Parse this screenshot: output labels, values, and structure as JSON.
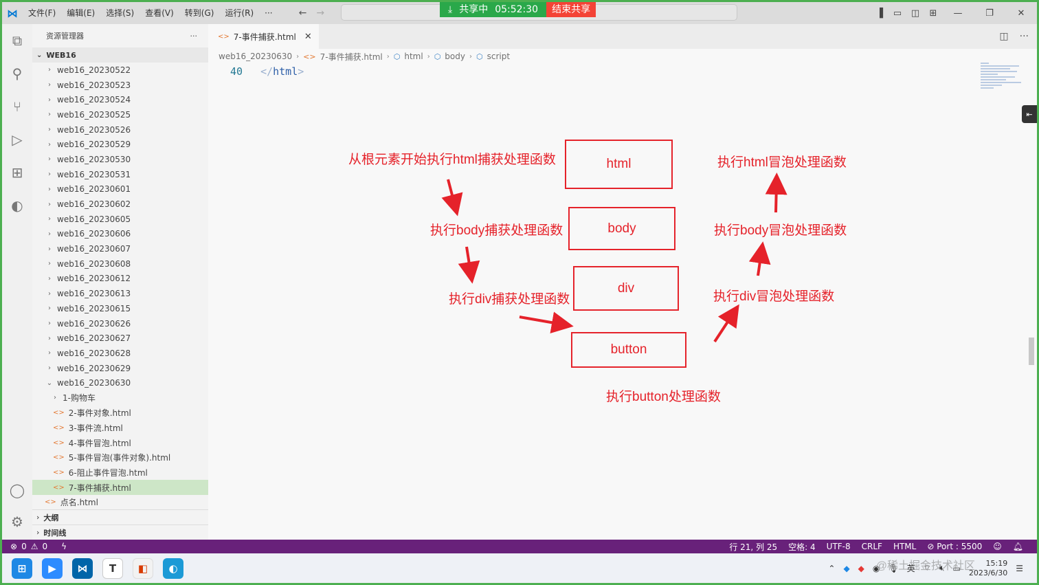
{
  "menu": [
    "文件(F)",
    "编辑(E)",
    "选择(S)",
    "查看(V)",
    "转到(G)",
    "运行(R)",
    "···"
  ],
  "share": {
    "status": "共享中",
    "timer": "05:52:30",
    "end_label": "结束共享"
  },
  "sidebar": {
    "title": "资源管理器",
    "more": "···",
    "root": "WEB16",
    "folders": [
      "web16_20230522",
      "web16_20230523",
      "web16_20230524",
      "web16_20230525",
      "web16_20230526",
      "web16_20230529",
      "web16_20230530",
      "web16_20230531",
      "web16_20230601",
      "web16_20230602",
      "web16_20230605",
      "web16_20230606",
      "web16_20230607",
      "web16_20230608",
      "web16_20230612",
      "web16_20230613",
      "web16_20230615",
      "web16_20230626",
      "web16_20230627",
      "web16_20230628",
      "web16_20230629"
    ],
    "open_folder": "web16_20230630",
    "children": [
      "1-购物车",
      "2-事件对象.html",
      "3-事件流.html",
      "4-事件冒泡.html",
      "5-事件冒泡(事件对象).html",
      "6-阻止事件冒泡.html",
      "7-事件捕获.html"
    ],
    "root_file": "点名.html",
    "outline": "大纲",
    "timeline": "时间线"
  },
  "tab": {
    "label": "7-事件捕获.html"
  },
  "breadcrumb": [
    "web16_20230630",
    "7-事件捕获.html",
    "html",
    "body",
    "script"
  ],
  "code": {
    "line_number": "40",
    "text": "</html>"
  },
  "diagram": {
    "boxes": [
      "html",
      "body",
      "div",
      "button"
    ],
    "capture_labels": [
      "从根元素开始执行html捕获处理函数",
      "执行body捕获处理函数",
      "执行div捕获处理函数"
    ],
    "bubble_labels": [
      "执行html冒泡处理函数",
      "执行body冒泡处理函数",
      "执行div冒泡处理函数"
    ],
    "target_label": "执行button处理函数"
  },
  "status": {
    "errors": "0",
    "warnings": "0",
    "position": "行 21, 列 25",
    "spaces": "空格: 4",
    "encoding": "UTF-8",
    "eol": "CRLF",
    "language": "HTML",
    "port": "Port : 5500"
  },
  "taskbar": {
    "ime": "英",
    "time": "15:19",
    "date": "2023/6/30",
    "watermark": "@稀土掘金技术社区"
  },
  "colors": {
    "annotation": "#e5222a",
    "statusbar": "#68217a",
    "accent": "#0078d4"
  }
}
